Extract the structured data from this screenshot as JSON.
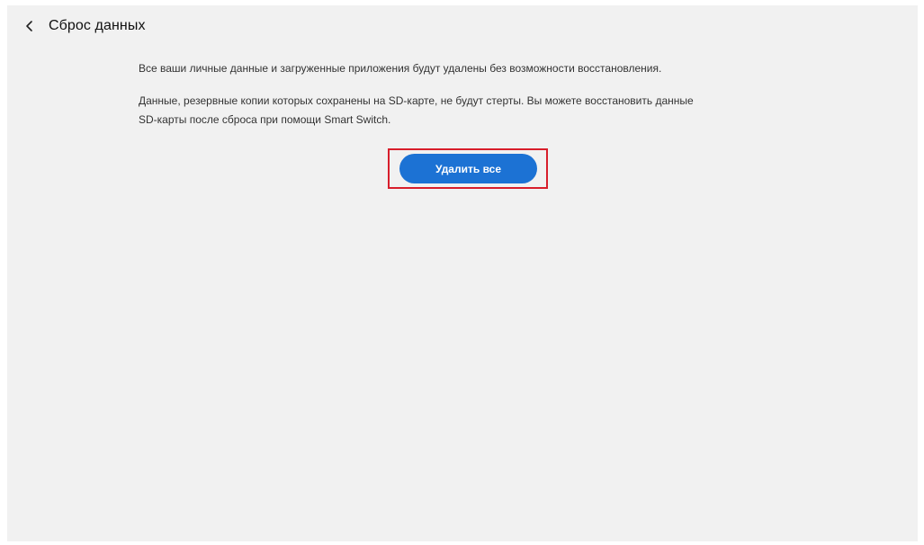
{
  "header": {
    "back_icon": "chevron-left-icon",
    "title": "Сброс данных"
  },
  "main": {
    "paragraph1": "Все ваши личные данные и загруженные приложения будут удалены без возможности восстановления.",
    "paragraph2_line1": "Данные, резервные копии которых сохранены на SD-карте, не будут стерты. Вы можете восстановить данные",
    "paragraph2_line2": "SD-карты после сброса при помощи Smart Switch.",
    "delete_button_label": "Удалить все"
  },
  "colors": {
    "background": "#f1f1f1",
    "accent": "#1c72d4",
    "highlight": "#d81e2b"
  }
}
